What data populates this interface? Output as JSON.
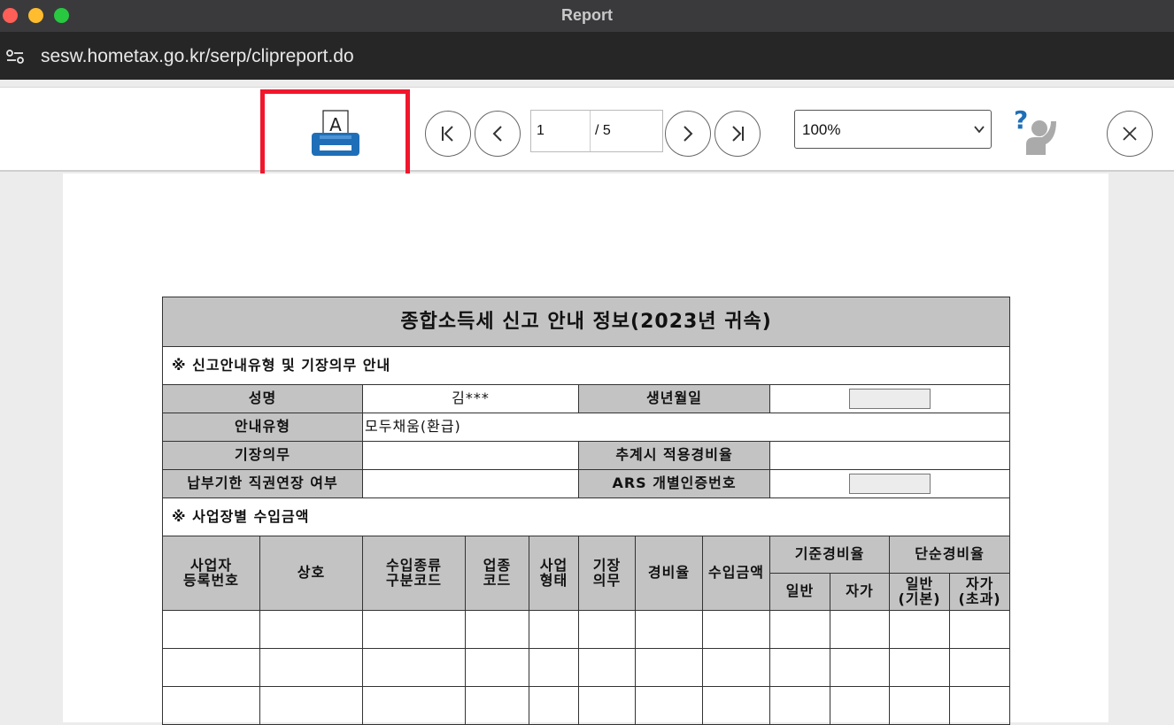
{
  "window": {
    "title": "Report"
  },
  "browser": {
    "url": "sesw.hometax.go.kr/serp/clipreport.do"
  },
  "toolbar": {
    "page_current": "1",
    "page_total": "/ 5",
    "zoom": "100%",
    "icons": [
      "printer-icon",
      "first-page-icon",
      "previous-page-icon",
      "next-page-icon",
      "last-page-icon",
      "help-icon",
      "close-icon"
    ],
    "highlight_color": "#f0172d"
  },
  "report": {
    "title": "종합소득세 신고 안내 정보(2023년 귀속)",
    "section1": "※ 신고안내유형 및 기장의무 안내",
    "name_label": "성명",
    "name_value": "김***",
    "birth_label": "생년월일",
    "type_label": "안내유형",
    "type_value": "모두채움(환급)",
    "bookkeeping_label": "기장의무",
    "est_rate_label": "추계시 적용경비율",
    "deadline_label": "납부기한 직권연장 여부",
    "ars_label": "ARS 개별인증번호",
    "section2": "※ 사업장별 수입금액",
    "columns": {
      "reg_no": [
        "사업자",
        "등록번호"
      ],
      "company": "상호",
      "income_code": [
        "수입종류",
        "구분코드"
      ],
      "industry_code": [
        "업종",
        "코드"
      ],
      "biz_type": [
        "사업",
        "형태"
      ],
      "bookkeeping": [
        "기장",
        "의무"
      ],
      "expense_rate": "경비율",
      "income_amount": "수입금액",
      "standard_rate": "기준경비율",
      "simple_rate": "단순경비율",
      "general": "일반",
      "self": "자가",
      "general_basic": [
        "일반",
        "(기본)"
      ],
      "self_excess": [
        "자가",
        "(초과)"
      ]
    },
    "rows": [
      [
        "",
        "",
        "",
        "",
        "",
        "",
        "",
        "",
        "",
        "",
        "",
        ""
      ],
      [
        "",
        "",
        "",
        "",
        "",
        "",
        "",
        "",
        "",
        "",
        "",
        ""
      ],
      [
        "",
        "",
        "",
        "",
        "",
        "",
        "",
        "",
        "",
        "",
        "",
        ""
      ]
    ]
  }
}
